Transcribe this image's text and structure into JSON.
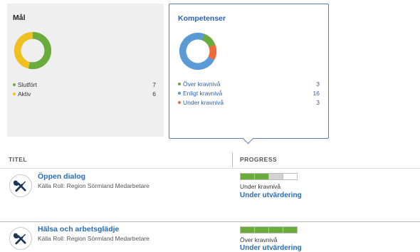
{
  "chart_data": [
    {
      "type": "pie",
      "donut": true,
      "title": "Mål",
      "categories": [
        "Slutfört",
        "Aktiv"
      ],
      "values": [
        7,
        6
      ],
      "colors": [
        "#6aab3c",
        "#f0c020"
      ],
      "legend": "bottom"
    },
    {
      "type": "pie",
      "donut": true,
      "title": "Kompetenser",
      "categories": [
        "Över kravnivå",
        "Enligt kravnivå",
        "Under kravnivå"
      ],
      "values": [
        3,
        16,
        3
      ],
      "colors": [
        "#6aab3c",
        "#5b9bd5",
        "#ef6a3a"
      ],
      "legend": "bottom"
    }
  ],
  "table": {
    "columns": [
      "TITEL",
      "PROGRESS"
    ]
  },
  "rows": [
    {
      "icon": "wrench-screwdriver-icon",
      "title": "Öppen dialog",
      "source": "Källa Roll: Region Sörmland Medarbetare",
      "progress": [
        "achieved",
        "achieved",
        "required",
        "empty"
      ],
      "level": "Under kravnivå",
      "status": "Under utvärdering"
    },
    {
      "icon": "wrench-screwdriver-icon",
      "title": "Hälsa och arbetsglädje",
      "source": "Källa Roll: Region Sörmland Medarbetare",
      "progress": [
        "achieved",
        "achieved",
        "achieved",
        "achieved"
      ],
      "level": "Över kravnivå",
      "status": "Under utvärdering"
    }
  ],
  "colors": {
    "accent": "#2a6db5",
    "card_border": "#5b7cbc",
    "segment_achieved": "#6aab3c",
    "segment_required": "#d3d3d3",
    "segment_empty": "#ffffff",
    "icon": "#1d3557"
  }
}
